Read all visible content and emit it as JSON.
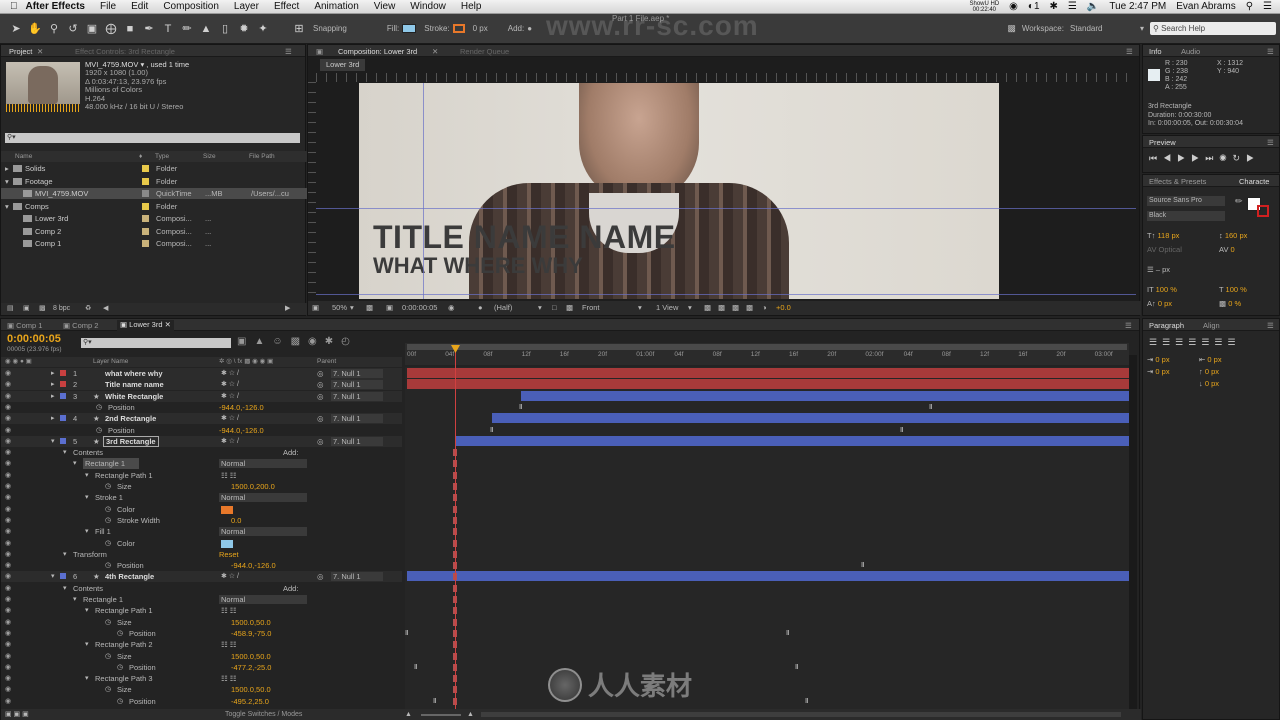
{
  "menubar": {
    "apple": "",
    "app_name": "After Effects",
    "menus": [
      "File",
      "Edit",
      "Composition",
      "Layer",
      "Effect",
      "Animation",
      "View",
      "Window",
      "Help"
    ],
    "status_top": "ShowU HD",
    "status_time_small": "00:22:40",
    "battery": "1",
    "clock": "Tue 2:47 PM",
    "user": "Evan Abrams"
  },
  "toolbar": {
    "snapping": "Snapping",
    "fill_label": "Fill:",
    "stroke_label": "Stroke:",
    "stroke_px": "0 px",
    "add_label": "Add:",
    "workspace_label": "Workspace:",
    "workspace_value": "Standard",
    "search_placeholder": "Search Help",
    "file_title": "Part 1 File.aep *"
  },
  "project": {
    "tab": "Project",
    "effect_controls_tab": "Effect Controls: 3rd Rectangle",
    "footage_name": "MVI_4759.MOV ▾ , used 1 time",
    "footage_info": [
      "1920 x 1080 (1.00)",
      "Δ 0:03:47:13, 23.976 fps",
      "Millions of Colors",
      "H.264",
      "48.000 kHz / 16 bit U / Stereo"
    ],
    "columns": {
      "name": "Name",
      "type": "Type",
      "size": "Size",
      "path": "File Path"
    },
    "items": [
      {
        "name": "Solids",
        "type": "Folder",
        "size": "",
        "path": "",
        "color": "#e8c94a"
      },
      {
        "name": "Footage",
        "type": "Folder",
        "size": "",
        "path": "",
        "color": "#e8c94a"
      },
      {
        "name": "MVI_4759.MOV",
        "type": "QuickTime",
        "size": "...MB",
        "path": "/Users/...cu",
        "color": "#8a8a8a"
      },
      {
        "name": "Comps",
        "type": "Folder",
        "size": "",
        "path": "",
        "color": "#e8c94a"
      },
      {
        "name": "Lower 3rd",
        "type": "Composi...",
        "size": "...",
        "path": "",
        "color": "#c9b27a"
      },
      {
        "name": "Comp 2",
        "type": "Composi...",
        "size": "...",
        "path": "",
        "color": "#c9b27a"
      },
      {
        "name": "Comp 1",
        "type": "Composi...",
        "size": "...",
        "path": "",
        "color": "#c9b27a"
      }
    ],
    "bpc": "8 bpc"
  },
  "composition": {
    "tab": "Composition: Lower 3rd",
    "render_queue": "Render Queue",
    "sub_tab": "Lower 3rd",
    "title_line1": "TITLE NAME NAME",
    "title_line2": "WHAT WHERE WHY",
    "zoom": "50%",
    "timecode": "0:00:00:05",
    "resolution": "(Half)",
    "view": "Front",
    "views": "1 View",
    "exposure": "+0.0"
  },
  "info": {
    "tab": "Info",
    "audio_tab": "Audio",
    "r": "R : 230",
    "g": "G : 238",
    "b": "B : 242",
    "a": "A : 255",
    "x": "X : 1312",
    "y": "Y : 940",
    "layer_name": "3rd Rectangle",
    "duration": "Duration: 0:00:30:00",
    "in_out": "In: 0:00:00:05, Out: 0:00:30:04"
  },
  "preview": {
    "tab": "Preview"
  },
  "character": {
    "effects_tab": "Effects & Presets",
    "char_tab": "Characte",
    "font": "Source Sans Pro",
    "style": "Black",
    "size": "118 px",
    "leading": "160 px",
    "kerning": "Optical",
    "tracking": "0",
    "stroke_px": "– px",
    "vscale": "100 %",
    "hscale": "100 %",
    "baseline": "0 px",
    "tsume": "0 %"
  },
  "paragraph": {
    "tab": "Paragraph",
    "align_tab": "Align",
    "indent_values": [
      "0 px",
      "0 px",
      "0 px",
      "0 px",
      "0 px"
    ]
  },
  "timeline": {
    "tabs": [
      "Comp 1",
      "Comp 2",
      "Lower 3rd"
    ],
    "timecode": "0:00:00:05",
    "fps": "00005 (23.976 fps)",
    "col_layer_name": "Layer Name",
    "col_parent": "Parent",
    "ruler": [
      "00f",
      "04f",
      "08f",
      "12f",
      "16f",
      "20f",
      "01:00f",
      "04f",
      "08f",
      "12f",
      "16f",
      "20f",
      "02:00f",
      "04f",
      "08f",
      "12f",
      "16f",
      "20f",
      "03:00f"
    ],
    "bottom_label": "Toggle Switches / Modes",
    "layers": [
      {
        "num": "1",
        "name": "what where why",
        "parent": "7. Null 1",
        "color": "#c84040",
        "type": "layer"
      },
      {
        "num": "2",
        "name": "Title name name",
        "parent": "7. Null 1",
        "color": "#c84040",
        "type": "layer"
      },
      {
        "num": "3",
        "name": "White Rectangle",
        "parent": "7. Null 1",
        "color": "#5b6fd0",
        "type": "layer"
      },
      {
        "num": "",
        "name": "Position",
        "value": "-944.0,-126.0",
        "type": "prop"
      },
      {
        "num": "4",
        "name": "2nd Rectangle",
        "parent": "7. Null 1",
        "color": "#5b6fd0",
        "type": "layer"
      },
      {
        "num": "",
        "name": "Position",
        "value": "-944.0,-126.0",
        "type": "prop"
      },
      {
        "num": "5",
        "name": "3rd Rectangle",
        "parent": "7. Null 1",
        "color": "#5b6fd0",
        "type": "layer"
      },
      {
        "num": "",
        "name": "Contents",
        "value": "Add:",
        "type": "group"
      },
      {
        "num": "",
        "name": "Rectangle 1",
        "value": "Normal",
        "type": "group2"
      },
      {
        "num": "",
        "name": "Rectangle Path 1",
        "value": "",
        "type": "group3"
      },
      {
        "num": "",
        "name": "Size",
        "value": "1500.0,200.0",
        "type": "prop4"
      },
      {
        "num": "",
        "name": "Stroke 1",
        "value": "Normal",
        "type": "group3"
      },
      {
        "num": "",
        "name": "Color",
        "value": "",
        "type": "prop4"
      },
      {
        "num": "",
        "name": "Stroke Width",
        "value": "0.0",
        "type": "prop4"
      },
      {
        "num": "",
        "name": "Fill 1",
        "value": "Normal",
        "type": "group3"
      },
      {
        "num": "",
        "name": "Color",
        "value": "",
        "type": "prop4"
      },
      {
        "num": "",
        "name": "Transform",
        "value": "Reset",
        "type": "group"
      },
      {
        "num": "",
        "name": "Position",
        "value": "-944.0,-126.0",
        "type": "prop4"
      },
      {
        "num": "6",
        "name": "4th Rectangle",
        "parent": "7. Null 1",
        "color": "#5b6fd0",
        "type": "layer"
      },
      {
        "num": "",
        "name": "Contents",
        "value": "Add:",
        "type": "group"
      },
      {
        "num": "",
        "name": "Rectangle 1",
        "value": "Normal",
        "type": "group2"
      },
      {
        "num": "",
        "name": "Rectangle Path 1",
        "value": "",
        "type": "group3"
      },
      {
        "num": "",
        "name": "Size",
        "value": "1500.0,50.0",
        "type": "prop4"
      },
      {
        "num": "",
        "name": "Position",
        "value": "-458.9,-75.0",
        "type": "prop5"
      },
      {
        "num": "",
        "name": "Rectangle Path 2",
        "value": "",
        "type": "group3"
      },
      {
        "num": "",
        "name": "Size",
        "value": "1500.0,50.0",
        "type": "prop4"
      },
      {
        "num": "",
        "name": "Position",
        "value": "-477.2,-25.0",
        "type": "prop5"
      },
      {
        "num": "",
        "name": "Rectangle Path 3",
        "value": "",
        "type": "group3"
      },
      {
        "num": "",
        "name": "Size",
        "value": "1500.0,50.0",
        "type": "prop4"
      },
      {
        "num": "",
        "name": "Position",
        "value": "-495.2,25.0",
        "type": "prop5"
      }
    ]
  },
  "watermark": {
    "top": "www.rr-sc.com",
    "bottom": "人人素材"
  },
  "colors": {
    "accent": "#e8a51b",
    "red_bar": "#a83a3a",
    "blue_bar": "#4a5fb8",
    "playhead": "#d04040",
    "stroke_swatch": "#e8782a",
    "fill_swatch": "#8fc8e8"
  }
}
